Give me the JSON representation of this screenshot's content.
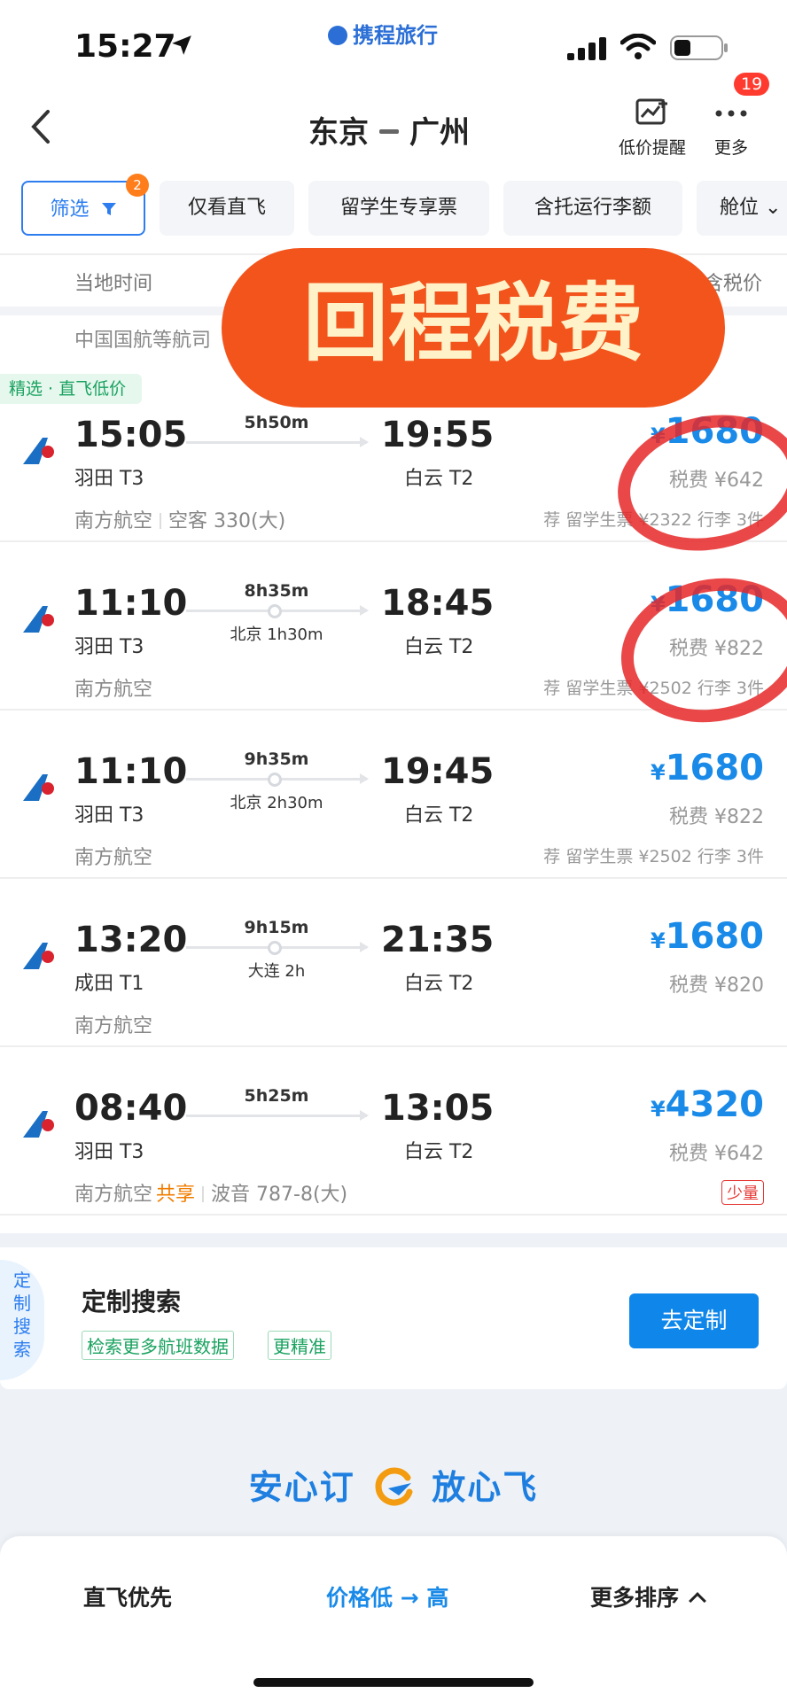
{
  "status_bar": {
    "time": "15:27",
    "brand": "携程旅行"
  },
  "header": {
    "origin": "东京",
    "destination": "广州",
    "price_alert_label": "低价提醒",
    "more_label": "更多",
    "notification_count": "19"
  },
  "filters": {
    "filter_label": "筛选",
    "filter_count": "2",
    "chips": [
      "仅看直飞",
      "留学生专享票",
      "含托运行李额",
      "舱位"
    ]
  },
  "sort_bar": {
    "left_label": "当地时间",
    "right_label": "含税价"
  },
  "airline_summary": "中国国航等航司",
  "banner_text": "回程税费",
  "picked_tag": "精选 · 直飞低价",
  "flights": [
    {
      "dep_time": "15:05",
      "dep_airport": "羽田 T3",
      "duration": "5h50m",
      "stop": "",
      "arr_time": "19:55",
      "arr_airport": "白云 T2",
      "airline": "南方航空",
      "aircraft": "空客 330(大)",
      "share": "",
      "currency": "¥",
      "price": "1680",
      "tax": "税费 ¥642",
      "recommend": "荐 留学生票 ¥2322 行李 3件",
      "tag": ""
    },
    {
      "dep_time": "11:10",
      "dep_airport": "羽田 T3",
      "duration": "8h35m",
      "stop": "北京 1h30m",
      "arr_time": "18:45",
      "arr_airport": "白云 T2",
      "airline": "南方航空",
      "aircraft": "",
      "share": "",
      "currency": "¥",
      "price": "1680",
      "tax": "税费 ¥822",
      "recommend": "荐 留学生票 ¥2502 行李 3件",
      "tag": ""
    },
    {
      "dep_time": "11:10",
      "dep_airport": "羽田 T3",
      "duration": "9h35m",
      "stop": "北京 2h30m",
      "arr_time": "19:45",
      "arr_airport": "白云 T2",
      "airline": "南方航空",
      "aircraft": "",
      "share": "",
      "currency": "¥",
      "price": "1680",
      "tax": "税费 ¥822",
      "recommend": "荐 留学生票 ¥2502 行李 3件",
      "tag": ""
    },
    {
      "dep_time": "13:20",
      "dep_airport": "成田 T1",
      "duration": "9h15m",
      "stop": "大连 2h",
      "arr_time": "21:35",
      "arr_airport": "白云 T2",
      "airline": "南方航空",
      "aircraft": "",
      "share": "",
      "currency": "¥",
      "price": "1680",
      "tax": "税费 ¥820",
      "recommend": "",
      "tag": ""
    },
    {
      "dep_time": "08:40",
      "dep_airport": "羽田 T3",
      "duration": "5h25m",
      "stop": "",
      "arr_time": "13:05",
      "arr_airport": "白云 T2",
      "airline": "南方航空",
      "aircraft": "波音 787-8(大)",
      "share": "共享",
      "currency": "¥",
      "price": "4320",
      "tax": "税费 ¥642",
      "recommend": "",
      "tag": "少量"
    }
  ],
  "custom_search": {
    "tab_label": "定制搜索",
    "title": "定制搜索",
    "tags": [
      "检索更多航班数据",
      "更精准"
    ],
    "button_label": "去定制"
  },
  "slogan": {
    "left": "安心订",
    "right": "放心飞"
  },
  "bottom_sort": {
    "direct_first": "直飞优先",
    "price_low_high": "价格低 → 高",
    "more_sort": "更多排序"
  },
  "colors": {
    "accent": "#1a8ae8",
    "brand": "#2b6fd6",
    "banner": "#f2541c",
    "banner_text": "#fff2c8",
    "annotation_circle": "#e62828"
  }
}
